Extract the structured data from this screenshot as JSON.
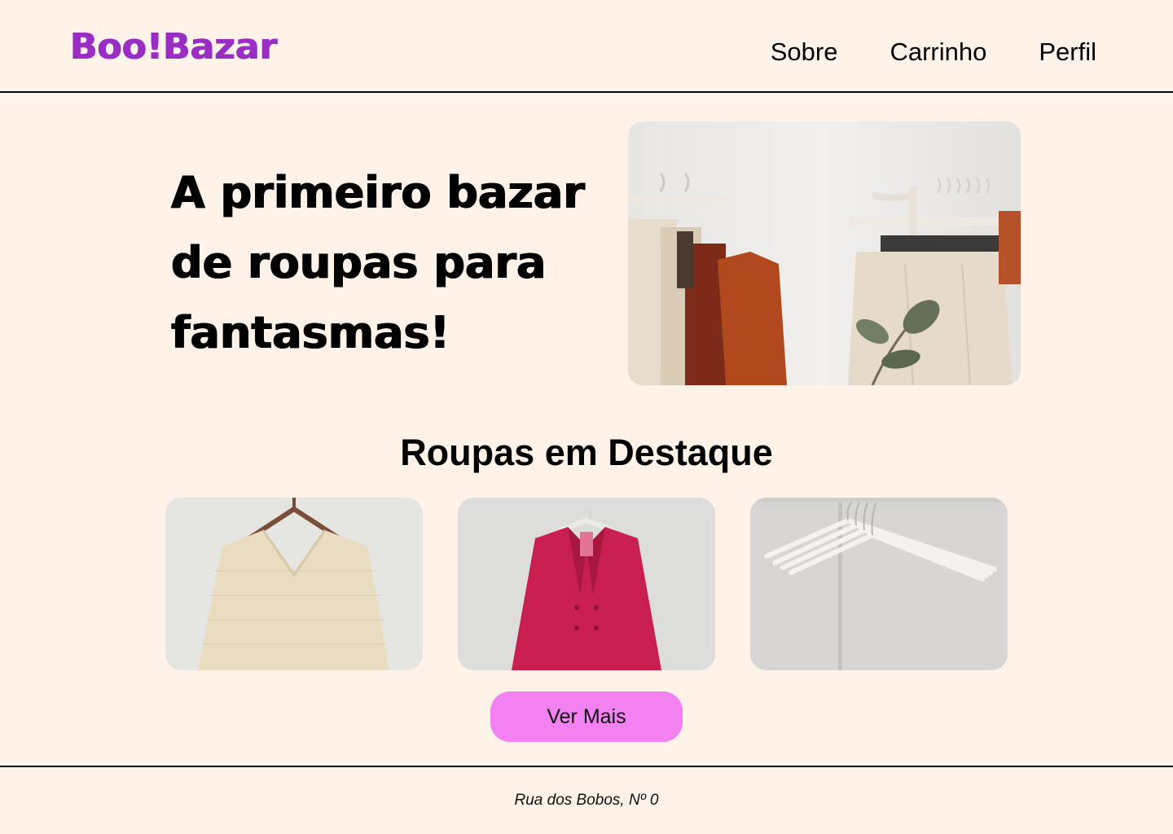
{
  "brand": {
    "logo": "Boo!Bazar",
    "logo_color": "#9A2DC4"
  },
  "nav": {
    "items": [
      {
        "label": "Sobre"
      },
      {
        "label": "Carrinho"
      },
      {
        "label": "Perfil"
      }
    ]
  },
  "hero": {
    "title": "A primeiro bazar de roupas para fantasmas!",
    "image_icon": "clothing-rack-photo"
  },
  "featured": {
    "title": "Roupas em Destaque",
    "products": [
      {
        "image": "knit-sweater-photo"
      },
      {
        "image": "red-blazer-photo"
      },
      {
        "image": "white-hangers-photo"
      }
    ],
    "cta": "Ver Mais",
    "cta_color": "#F481F1"
  },
  "footer": {
    "address": "Rua dos Bobos, Nº 0"
  },
  "colors": {
    "background": "#FFF2E9",
    "accent": "#9A2DC4"
  }
}
